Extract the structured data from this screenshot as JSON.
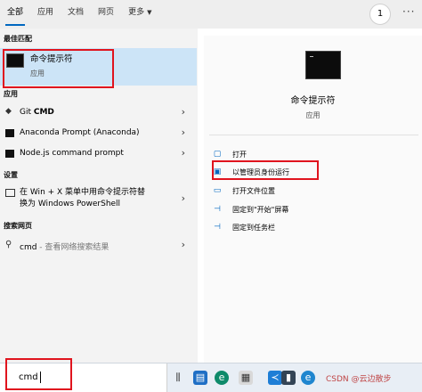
{
  "tabs": {
    "all": "全部",
    "apps": "应用",
    "documents": "文档",
    "web": "网页",
    "more": "更多"
  },
  "badge_count": "1",
  "more_menu": "···",
  "left": {
    "best_match_title": "最佳匹配",
    "best_match": {
      "name": "命令提示符",
      "type": "应用"
    },
    "apps_title": "应用",
    "apps": [
      {
        "name_plain": "Git ",
        "name_bold": "CMD"
      },
      {
        "name": "Anaconda Prompt (Anaconda)"
      },
      {
        "name": "Node.js command prompt"
      }
    ],
    "settings_title": "设置",
    "settings_item_line1": "在 Win + X 菜单中用命令提示符替",
    "settings_item_line2": "换为 Windows PowerShell",
    "web_title": "搜索网页",
    "web_query": "cmd",
    "web_hint": " - 查看网络搜索结果"
  },
  "right": {
    "title": "命令提示符",
    "subtitle": "应用",
    "actions": [
      {
        "label": "打开"
      },
      {
        "label": "以管理员身份运行"
      },
      {
        "label": "打开文件位置"
      },
      {
        "label": "固定到\"开始\"屏幕"
      },
      {
        "label": "固定到任务栏"
      }
    ]
  },
  "search": {
    "value": "cmd"
  },
  "watermark": "CSDN @云边散步"
}
